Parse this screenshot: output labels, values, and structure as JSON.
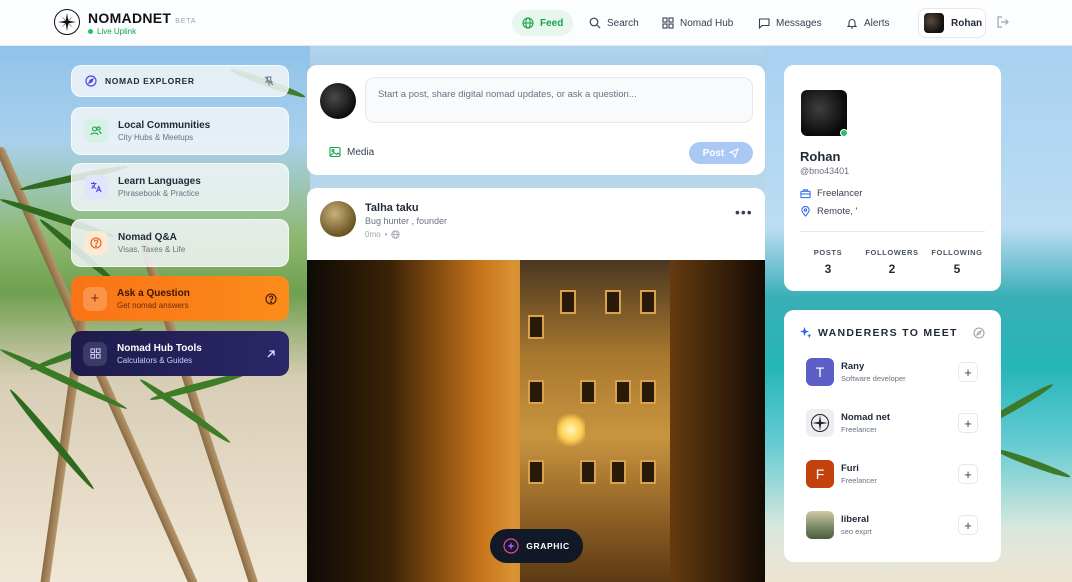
{
  "brand": {
    "name": "NOMADNET",
    "beta": "BETA",
    "status": "Live Uplink"
  },
  "nav": {
    "feed": "Feed",
    "search": "Search",
    "hub": "Nomad Hub",
    "messages": "Messages",
    "alerts": "Alerts",
    "user": "Rohan"
  },
  "sidebar": {
    "explorer": "NOMAD EXPLORER",
    "items": [
      {
        "title": "Local Communities",
        "sub": "City Hubs & Meetups"
      },
      {
        "title": "Learn Languages",
        "sub": "Phrasebook & Practice"
      },
      {
        "title": "Nomad Q&A",
        "sub": "Visas, Taxes & Life"
      },
      {
        "title": "Ask a Question",
        "sub": "Get nomad answers"
      },
      {
        "title": "Nomad Hub Tools",
        "sub": "Calculators & Guides"
      }
    ]
  },
  "composer": {
    "placeholder": "Start a post, share digital nomad updates, or ask a question...",
    "media": "Media",
    "post": "Post"
  },
  "post": {
    "author": "Talha taku",
    "role": "Bug hunter , founder",
    "time": "0mo",
    "tag": "GRAPHIC"
  },
  "profile": {
    "name": "Rohan",
    "handle": "@bno43401",
    "job": "Freelancer",
    "location": "Remote, '",
    "stats": [
      {
        "label": "POSTS",
        "value": "3"
      },
      {
        "label": "FOLLOWERS",
        "value": "2"
      },
      {
        "label": "FOLLOWING",
        "value": "5"
      }
    ]
  },
  "wanderers": {
    "title": "WANDERERS TO MEET",
    "people": [
      {
        "name": "Rany",
        "sub": "Software developer",
        "initial": "T",
        "color": "#5b5fc7"
      },
      {
        "name": "Nomad net",
        "sub": "Freelancer",
        "initial": "",
        "color": "#f3f4f6"
      },
      {
        "name": "Furi",
        "sub": "Freelancer",
        "initial": "F",
        "color": "#c2410c"
      },
      {
        "name": "liberal",
        "sub": "seo exprt",
        "initial": "",
        "color": "#9aa88a"
      }
    ]
  }
}
